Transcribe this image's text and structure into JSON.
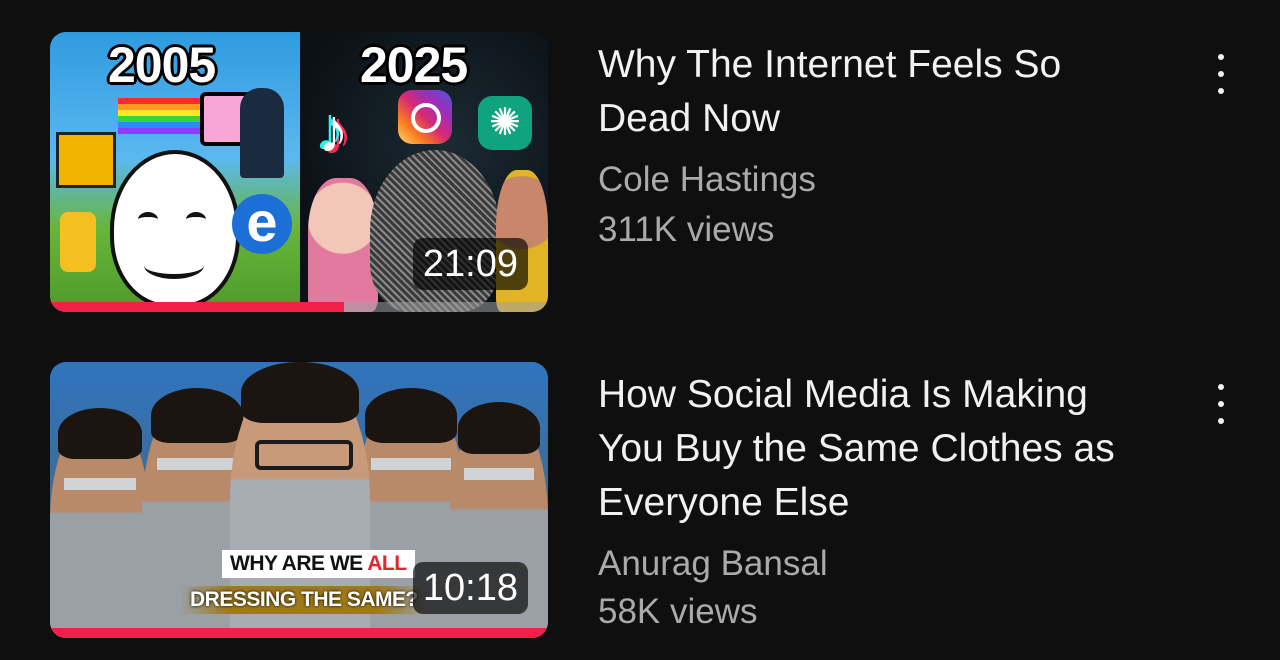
{
  "videos": [
    {
      "title": "Why The Internet Feels So Dead Now",
      "channel": "Cole Hastings",
      "views": "311K views",
      "duration": "21:09",
      "watch_progress": 0.59,
      "thumbnail_text": {
        "left": "2005",
        "right": "2025",
        "icon_e": "e",
        "icon_tiktok": "♪",
        "icon_gpt": "✺"
      },
      "menu_icon": "more-vert-icon"
    },
    {
      "title": "How Social Media Is Making You Buy the Same Clothes as Everyone Else",
      "channel": "Anurag Bansal",
      "views": "58K views",
      "duration": "10:18",
      "watch_progress": 1.0,
      "thumbnail_text": {
        "line1_part1": "WHY ARE WE ",
        "line1_part2": "ALL",
        "line2": "DRESSING THE SAME?"
      },
      "menu_icon": "more-vert-icon"
    }
  ],
  "colors": {
    "background": "#0f0f0f",
    "progress": "#f0204a",
    "title": "#f1f1f1",
    "meta": "#aaaaaa"
  }
}
